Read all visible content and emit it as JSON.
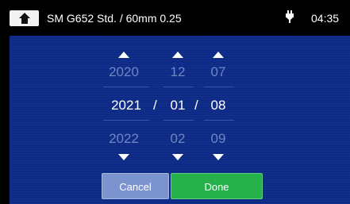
{
  "header": {
    "home_icon": "home-icon",
    "title": "SM G652 Std. / 60mm 0.25",
    "power_icon": "plug-icon",
    "time": "04:35"
  },
  "date_picker": {
    "year": {
      "prev": "2020",
      "current": "2021",
      "next": "2022"
    },
    "month": {
      "prev": "12",
      "current": "01",
      "next": "02"
    },
    "day": {
      "prev": "07",
      "current": "08",
      "next": "09"
    },
    "separator": "/"
  },
  "actions": {
    "cancel_label": "Cancel",
    "done_label": "Done"
  },
  "colors": {
    "panel_bg": "#0d2a86",
    "done_bg": "#27b14b",
    "cancel_bg": "#7b93cf"
  }
}
